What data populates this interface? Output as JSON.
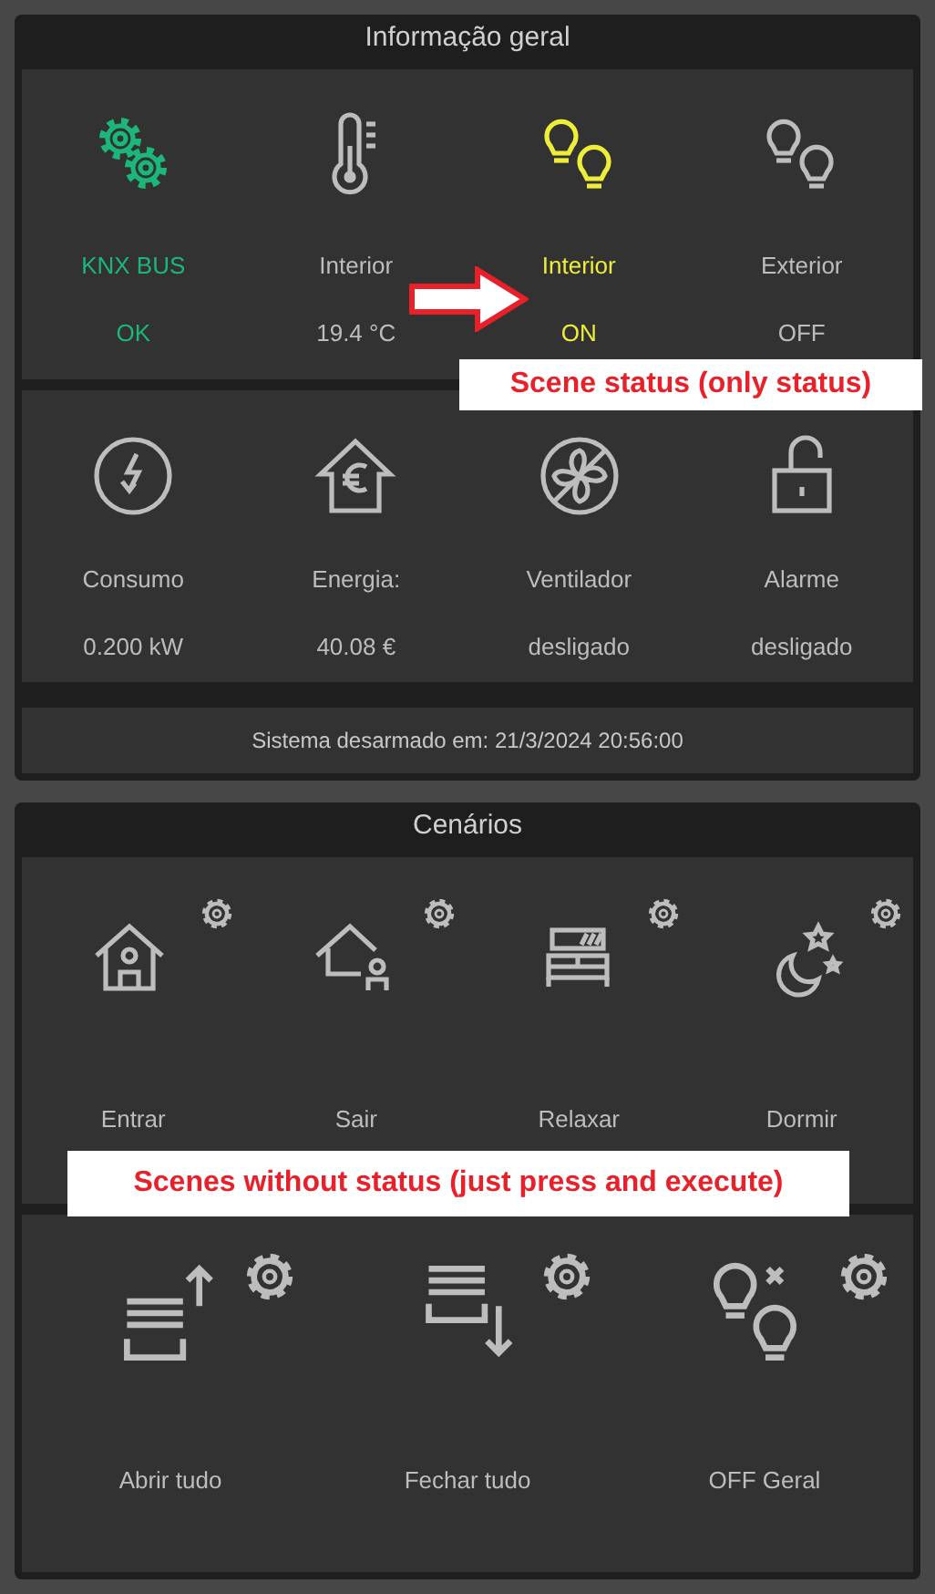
{
  "panels": [
    {
      "title": "Informação geral",
      "cards": [
        {
          "items": [
            {
              "label": "KNX BUS",
              "value": "OK",
              "color": "#1db67a"
            },
            {
              "label": "Interior",
              "value": "19.4 °C",
              "color": "#bdbdbd"
            },
            {
              "label": "Interior",
              "value": "ON",
              "color": "#eeee3a"
            },
            {
              "label": "Exterior",
              "value": "OFF",
              "color": "#bdbdbd"
            }
          ]
        },
        {
          "items": [
            {
              "label": "Consumo",
              "value": "0.200 kW",
              "color": "#bdbdbd"
            },
            {
              "label": "Energia:",
              "value": "40.08 €",
              "color": "#bdbdbd"
            },
            {
              "label": "Ventilador",
              "value": "desligado",
              "color": "#bdbdbd"
            },
            {
              "label": "Alarme",
              "value": "desligado",
              "color": "#bdbdbd"
            }
          ]
        }
      ],
      "footer": "Sistema desarmado em: 21/3/2024 20:56:00",
      "callout": "Scene status (only status)"
    },
    {
      "title": "Cenários",
      "cards": [
        {
          "items": [
            {
              "label": "Entrar"
            },
            {
              "label": "Sair"
            },
            {
              "label": "Relaxar"
            },
            {
              "label": "Dormir"
            }
          ]
        },
        {
          "items": [
            {
              "label": "Abrir tudo"
            },
            {
              "label": "Fechar tudo"
            },
            {
              "label": "OFF Geral"
            }
          ]
        }
      ],
      "callout": "Scenes without status (just press and execute)"
    }
  ]
}
